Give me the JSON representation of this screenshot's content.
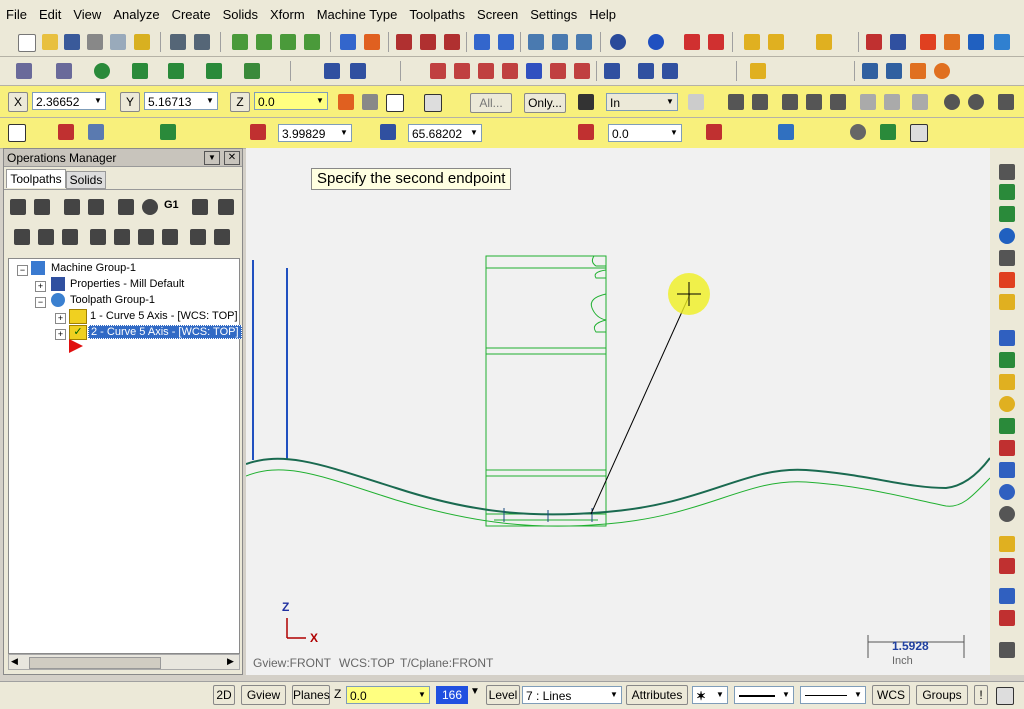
{
  "menu": [
    "File",
    "Edit",
    "View",
    "Analyze",
    "Create",
    "Solids",
    "Xform",
    "Machine Type",
    "Toolpaths",
    "Screen",
    "Settings",
    "Help"
  ],
  "coords": {
    "x_label": "X",
    "x_value": "2.36652",
    "y_label": "Y",
    "y_value": "5.16713",
    "z_label": "Z",
    "z_value": "0.0",
    "all_label": "All...",
    "only_label": "Only...",
    "in_value": "In"
  },
  "ribbon": {
    "length_value": "3.99829",
    "angle_value": "65.68202",
    "third_value": "0.0"
  },
  "ops": {
    "title": "Operations Manager",
    "tabs": [
      "Toolpaths",
      "Solids"
    ],
    "tree": [
      {
        "label": "Machine Group-1"
      },
      {
        "label": "Properties - Mill Default"
      },
      {
        "label": "Toolpath Group-1"
      },
      {
        "label": "1 - Curve 5 Axis - [WCS: TOP]"
      },
      {
        "label": "2 - Curve 5 Axis - [WCS: TOP]"
      }
    ]
  },
  "graphics": {
    "prompt": "Specify the second endpoint",
    "axis_z": "Z",
    "axis_x": "X",
    "gview": "Gview:FRONT",
    "wcs": "WCS:TOP",
    "cplane": "T/Cplane:FRONT",
    "scale_value": "1.5928",
    "scale_unit": "Inch"
  },
  "status": {
    "btn_2d": "2D",
    "gview": "Gview",
    "planes": "Planes",
    "z_label": "Z",
    "z_value": "0.0",
    "color_value": "166",
    "level_label": "Level",
    "level_value": "7 : Lines",
    "attributes": "Attributes",
    "wcs": "WCS",
    "groups": "Groups",
    "help": "!"
  }
}
